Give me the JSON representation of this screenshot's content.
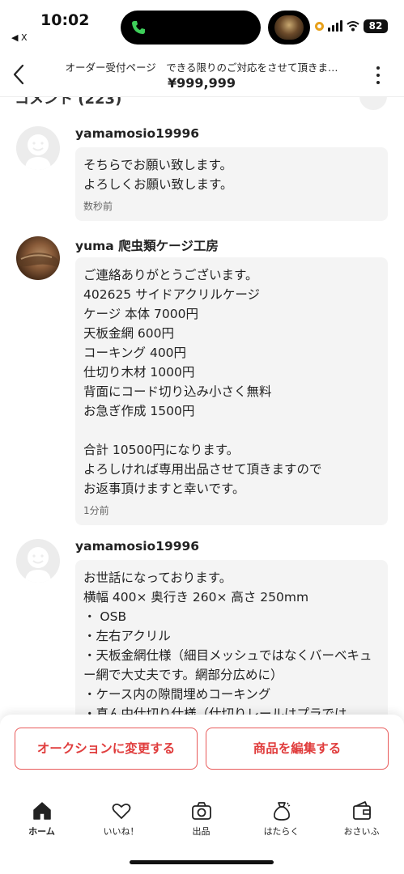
{
  "status": {
    "time": "10:02",
    "back_app": "◀ X",
    "battery": "82"
  },
  "header": {
    "title": "オーダー受付ページ　できる限りのご対応をさせて頂きま…",
    "price": "¥999,999"
  },
  "comments_section": {
    "heading": "コメント (223)"
  },
  "comments": [
    {
      "user": "yamamosio19996",
      "text": "そちらでお願い致します。\nよろしくお願い致します。",
      "time": "数秒前"
    },
    {
      "user": "yuma 爬虫類ケージ工房",
      "text": "ご連絡ありがとうございます。\n402625 サイドアクリルケージ\nケージ 本体 7000円\n天板金網 600円\nコーキング 400円\n仕切り木材 1000円\n背面にコード切り込み小さく無料\nお急ぎ作成 1500円\n\n合計 10500円になります。\nよろしければ専用出品させて頂きますので\nお返事頂けますと幸いです。",
      "time": "1分前"
    },
    {
      "user": "yamamosio19996",
      "text": "お世話になっております。\n横幅 400× 奥行き 260× 高さ 250mm\n・ OSB\n・左右アクリル\n・天板金網仕様（細目メッシュではなくバーベキュー網で大丈夫です。網部分広めに）\n・ケース内の隙間埋めコーキング\n・真ん中仕切り仕様（仕切りレールはプラでは",
      "time": ""
    }
  ],
  "actions": {
    "auction_label": "オークションに変更する",
    "edit_label": "商品を編集する"
  },
  "tabs": [
    {
      "label": "ホーム",
      "icon": "home-icon"
    },
    {
      "label": "いいね！",
      "icon": "heart-icon"
    },
    {
      "label": "出品",
      "icon": "camera-icon"
    },
    {
      "label": "はたらく",
      "icon": "money-bag-icon"
    },
    {
      "label": "おさいふ",
      "icon": "wallet-icon"
    }
  ],
  "colors": {
    "accent": "#e03d3d",
    "bubble": "#f4f4f4"
  }
}
